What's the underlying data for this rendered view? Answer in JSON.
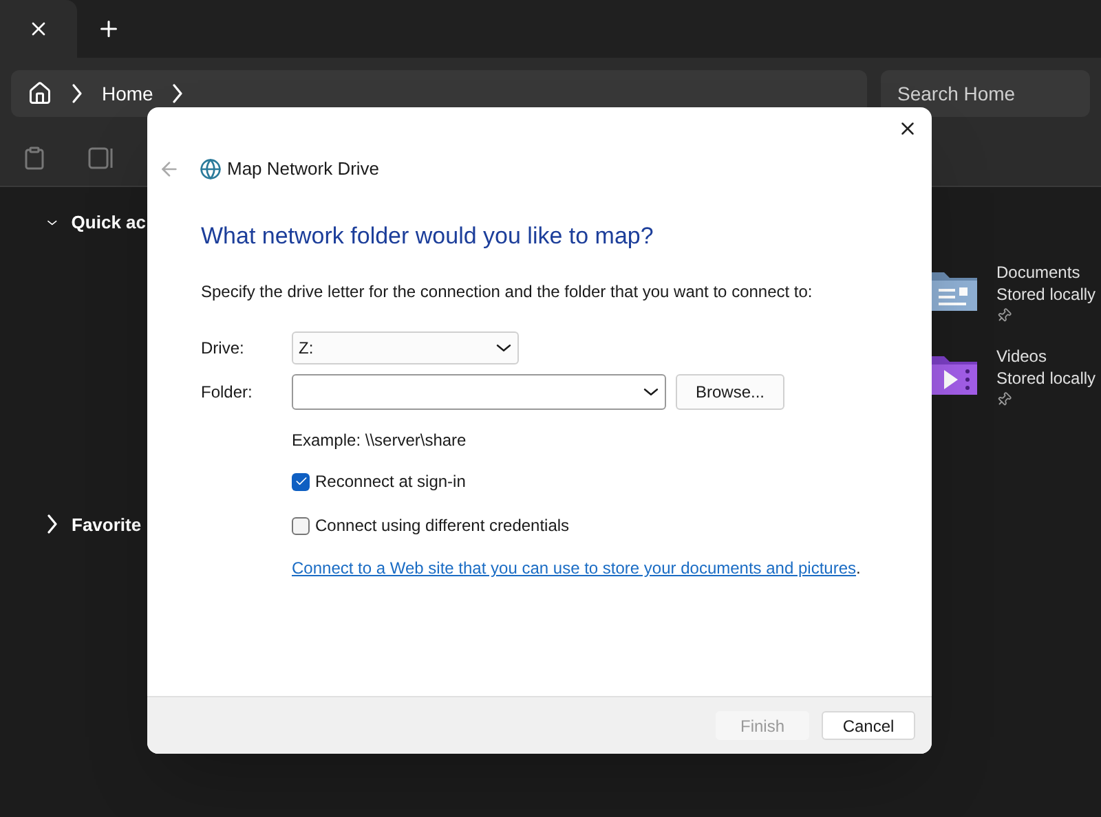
{
  "explorer": {
    "breadcrumb": "Home",
    "search": {
      "placeholder": "Search Home"
    },
    "nav": [
      {
        "label": "Quick ac",
        "expanded": true
      },
      {
        "label": "Favorite",
        "expanded": false
      }
    ],
    "folders": [
      {
        "kind": "documents",
        "name": "Documents",
        "status": "Stored locally",
        "pinned": true
      },
      {
        "kind": "videos",
        "name": "Videos",
        "status": "Stored locally",
        "pinned": true
      }
    ]
  },
  "dialog": {
    "title": "Map Network Drive",
    "heading": "What network folder would you like to map?",
    "instruction": "Specify the drive letter for the connection and the folder that you want to connect to:",
    "drive": {
      "label": "Drive:",
      "value": "Z:"
    },
    "folder": {
      "label": "Folder:",
      "browse": "Browse..."
    },
    "example": "Example: \\\\server\\share",
    "options": [
      {
        "label": "Reconnect at sign-in",
        "checked": true
      },
      {
        "label": "Connect using different credentials",
        "checked": false
      }
    ],
    "link": "Connect to a Web site that you can use to store your documents and pictures",
    "link_suffix": ".",
    "buttons": [
      {
        "label": "Finish",
        "disabled": true
      },
      {
        "label": "Cancel",
        "disabled": false
      }
    ]
  }
}
